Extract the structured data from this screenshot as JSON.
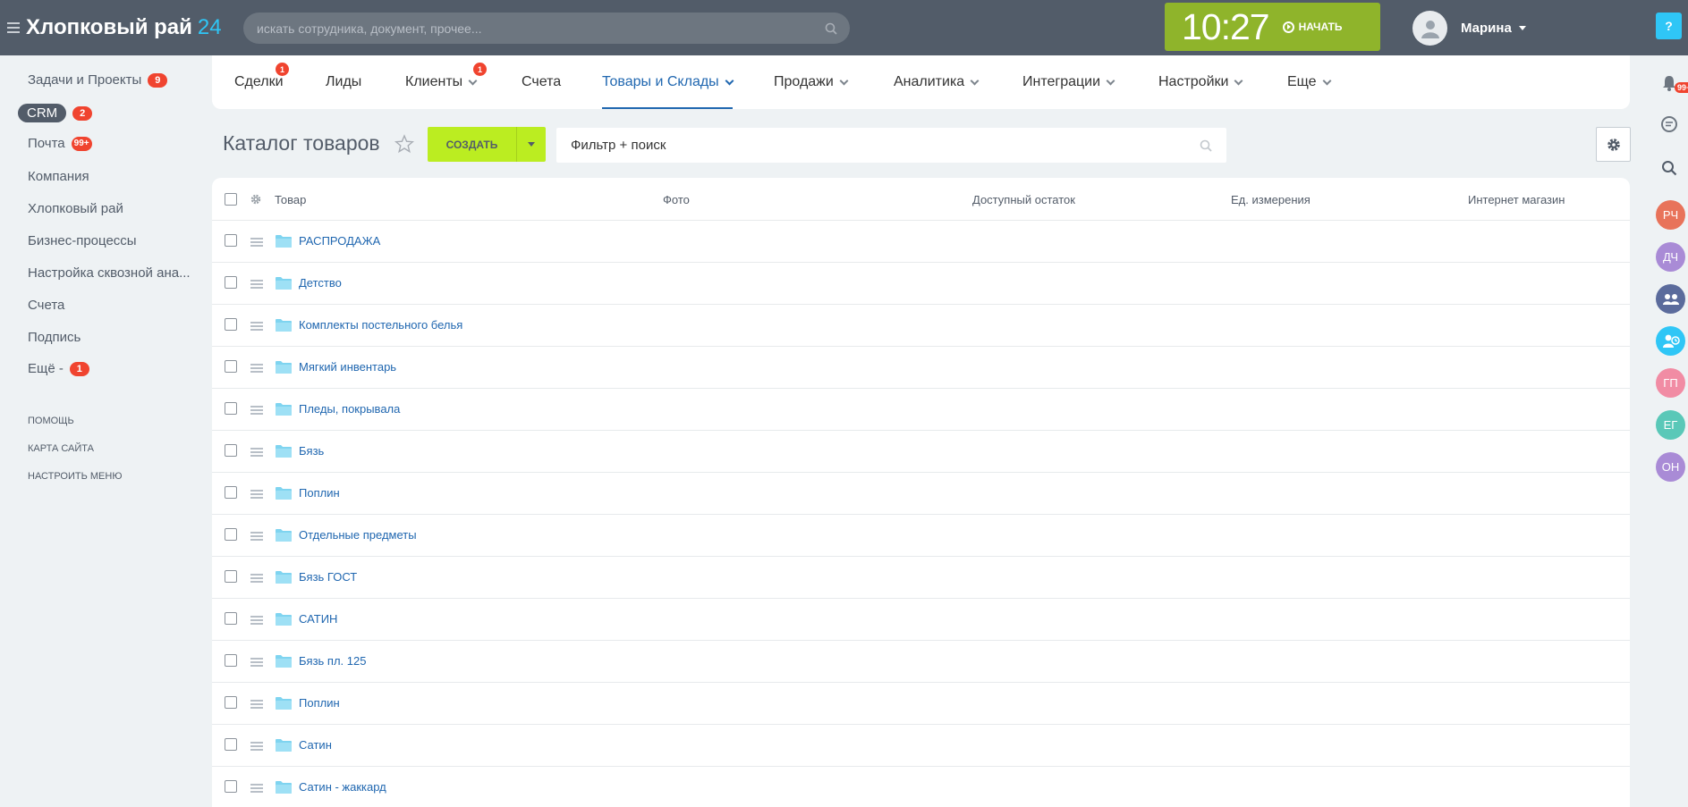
{
  "header": {
    "logo_name": "Хлопковый рай",
    "logo_num": "24",
    "search_placeholder": "искать сотрудника, документ, прочее...",
    "clock": "10:27",
    "start_label": "НАЧАТЬ",
    "user_name": "Марина",
    "help": "?"
  },
  "sidebar": {
    "items": [
      {
        "label": "Задачи и Проекты",
        "badge": "9"
      },
      {
        "label": "CRM",
        "badge": "2"
      },
      {
        "label": "Почта",
        "badge": "99+"
      },
      {
        "label": "Компания",
        "badge": ""
      },
      {
        "label": "Хлопковый рай",
        "badge": ""
      },
      {
        "label": "Бизнес-процессы",
        "badge": ""
      },
      {
        "label": "Настройка сквозной ана...",
        "badge": ""
      },
      {
        "label": "Счета",
        "badge": ""
      },
      {
        "label": "Подпись",
        "badge": ""
      },
      {
        "label": "Ещё -",
        "badge": "1"
      }
    ],
    "links": [
      "ПОМОЩЬ",
      "КАРТА САЙТА",
      "НАСТРОИТЬ МЕНЮ"
    ]
  },
  "nav": {
    "tabs": [
      {
        "label": "Сделки",
        "badge": "1"
      },
      {
        "label": "Лиды",
        "badge": ""
      },
      {
        "label": "Клиенты",
        "badge": "1"
      },
      {
        "label": "Счета",
        "badge": ""
      },
      {
        "label": "Товары и Склады",
        "badge": ""
      },
      {
        "label": "Продажи",
        "badge": ""
      },
      {
        "label": "Аналитика",
        "badge": ""
      },
      {
        "label": "Интеграции",
        "badge": ""
      },
      {
        "label": "Настройки",
        "badge": ""
      },
      {
        "label": "Еще",
        "badge": ""
      }
    ],
    "active": "Товары и Склады"
  },
  "toolbar": {
    "title": "Каталог товаров",
    "create_label": "СОЗДАТЬ",
    "filter_text": "Фильтр + поиск"
  },
  "grid": {
    "columns": [
      "Товар",
      "Фото",
      "Доступный остаток",
      "Ед. измерения",
      "Интернет магазин"
    ],
    "rows": [
      "РАСПРОДАЖА",
      "Детство",
      "Комплекты постельного белья",
      "Мягкий инвентарь",
      "Пледы, покрывала",
      "Бязь",
      "Поплин",
      "Отдельные предметы",
      "Бязь ГОСТ",
      "САТИН",
      "Бязь пл. 125",
      "Поплин",
      "Сатин",
      "Сатин - жаккард"
    ]
  },
  "rightbar": {
    "notif_badge": "99+",
    "avatars": [
      {
        "initials": "РЧ",
        "color": "#e8735a"
      },
      {
        "initials": "ДЧ",
        "color": "#a98bd6"
      },
      {
        "initials": "ГП",
        "color": "#f18ca4"
      },
      {
        "initials": "ЕГ",
        "color": "#5ac8b8"
      },
      {
        "initials": "ОН",
        "color": "#a98bd6"
      }
    ]
  },
  "colors": {
    "header_bg": "#525c69",
    "accent_blue": "#2067b0",
    "create_green": "#bbed21",
    "clock_green": "#8fb42b",
    "badge_red": "#f0442f",
    "folder_blue": "#7fd4f0"
  }
}
